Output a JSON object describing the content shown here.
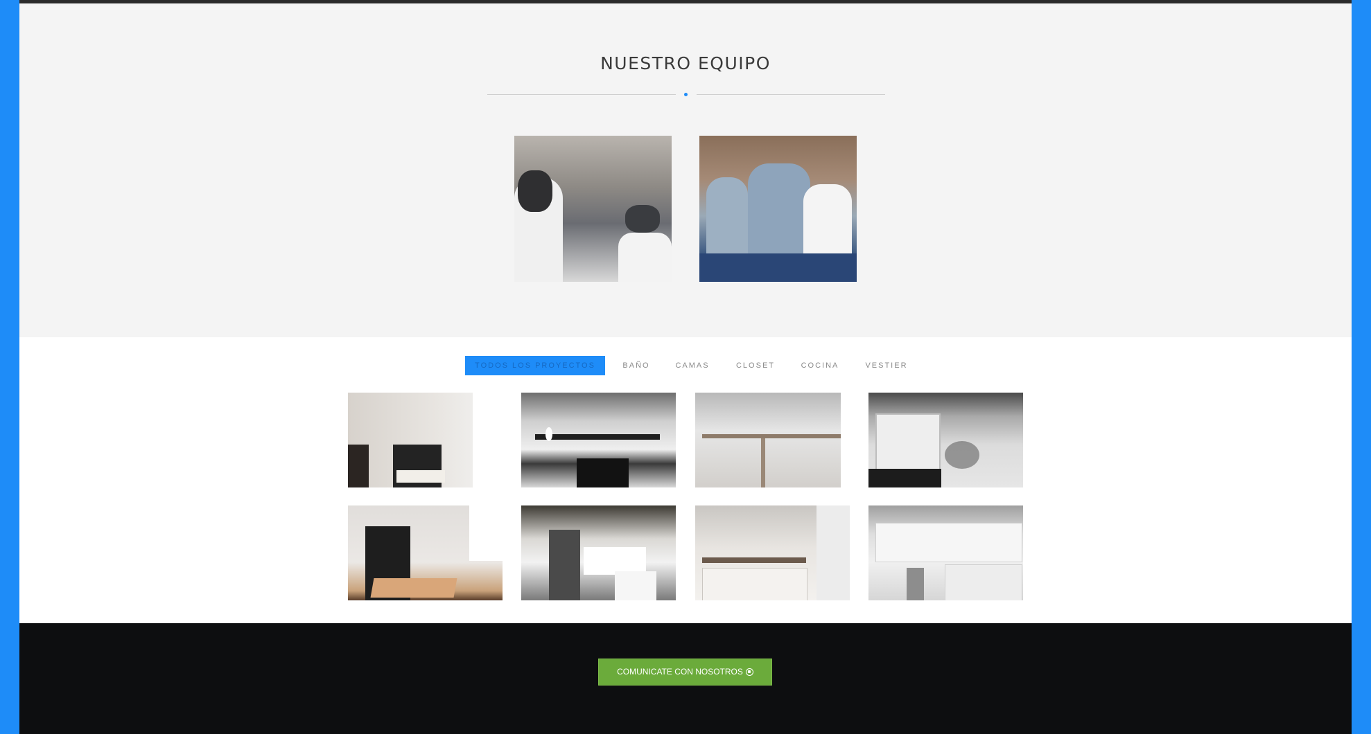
{
  "team": {
    "title": "NUESTRO EQUIPO",
    "accent_color": "#1e8cf8"
  },
  "portfolio": {
    "filters": [
      {
        "label": "TODOS LOS PROYECTOS",
        "active": true
      },
      {
        "label": "BAÑO",
        "active": false
      },
      {
        "label": "CAMAS",
        "active": false
      },
      {
        "label": "CLOSET",
        "active": false
      },
      {
        "label": "COCINA",
        "active": false
      },
      {
        "label": "VESTIER",
        "active": false
      }
    ]
  },
  "cta": {
    "label": "COMUNICATE CON NOSOTROS",
    "icon": "whatsapp-icon",
    "color": "#6bab3b"
  },
  "colors": {
    "frame": "#1e8cf8",
    "footer": "#0d0e10",
    "section_bg": "#f4f4f4"
  }
}
